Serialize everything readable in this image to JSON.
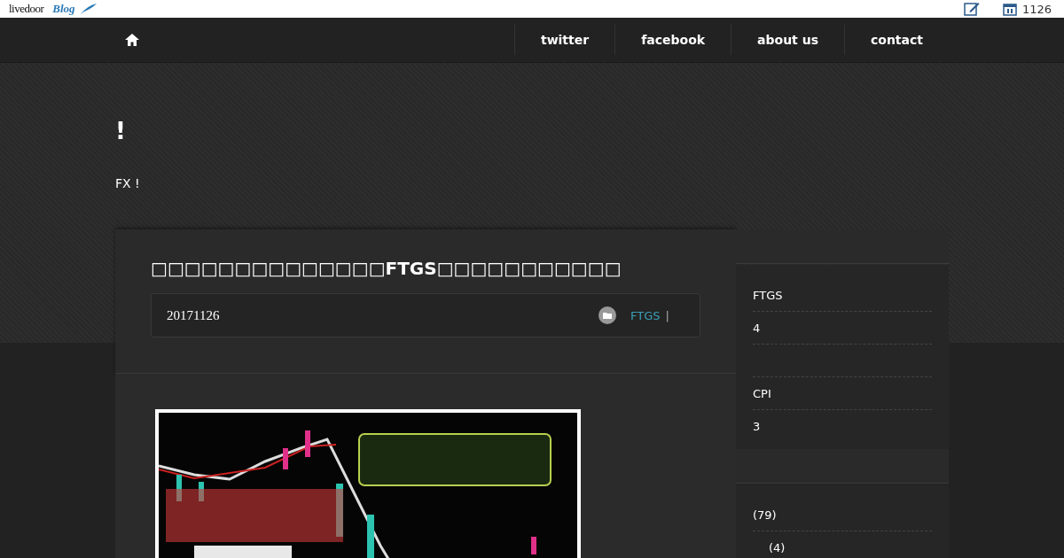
{
  "topbar": {
    "brand": "livedoor",
    "brand_sub": "Blog",
    "counter": "1126"
  },
  "nav": {
    "items": [
      {
        "label": "twitter"
      },
      {
        "label": "facebook"
      },
      {
        "label": "about us"
      },
      {
        "label": "contact"
      }
    ]
  },
  "blog": {
    "title": "!",
    "description": "FX !"
  },
  "article": {
    "title": "□□□□□□□□□□□□□□FTGS□□□□□□□□□□□",
    "date": "20171126",
    "category": "FTGS",
    "separator": "|"
  },
  "sidebar": {
    "sections": [
      {
        "items": [
          {
            "kind": "text",
            "label": "FTGS"
          },
          {
            "kind": "text",
            "label": "4"
          },
          {
            "kind": "spacer"
          },
          {
            "kind": "text",
            "label": "CPI"
          },
          {
            "kind": "text",
            "label": "3"
          }
        ]
      },
      {
        "items": [
          {
            "kind": "text",
            "label": "(79)"
          },
          {
            "kind": "indent",
            "label": "(4)"
          }
        ]
      }
    ]
  }
}
